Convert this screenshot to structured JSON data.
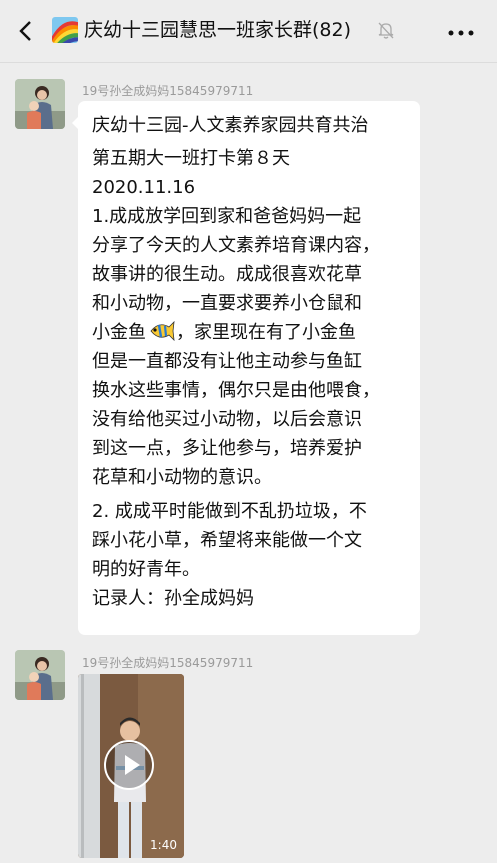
{
  "header": {
    "title": "庆幼十三园慧思一班家长群(82)",
    "back_icon": "chevron-left-icon",
    "group_icon": "rainbow-icon",
    "mute_icon": "muted-bell-icon",
    "more_icon": "ellipsis-icon"
  },
  "messages": [
    {
      "sender": "19号孙全成妈妈15845979711",
      "lines": [
        "庆幼十三园-人文素养家园共育共治",
        "第五期大一班打卡第８天",
        "    2020.11.16",
        " 1.成成放学回到家和爸爸妈妈一起",
        "分享了今天的人文素养培育课内容，",
        "故事讲的很生动。成成很喜欢花草",
        "和小动物，一直要求要养小仓鼠和",
        "小金鱼",
        "，家里现在有了小金鱼",
        "但是一直都没有让他主动参与鱼缸",
        "换水这些事情，偶尔只是由他喂食，",
        "没有给他买过小动物，以后会意识",
        "到这一点，多让他参与，培养爱护",
        "花草和小动物的意识。",
        "2. 成成平时能做到不乱扔垃圾，不",
        "踩小花小草，希望将来能做一个文",
        "明的好青年。",
        "  记录人：孙全成妈妈"
      ],
      "emoji": "fish-emoji"
    },
    {
      "sender": "19号孙全成妈妈15845979711",
      "video_duration": "1:40",
      "play_icon": "play-icon"
    }
  ]
}
